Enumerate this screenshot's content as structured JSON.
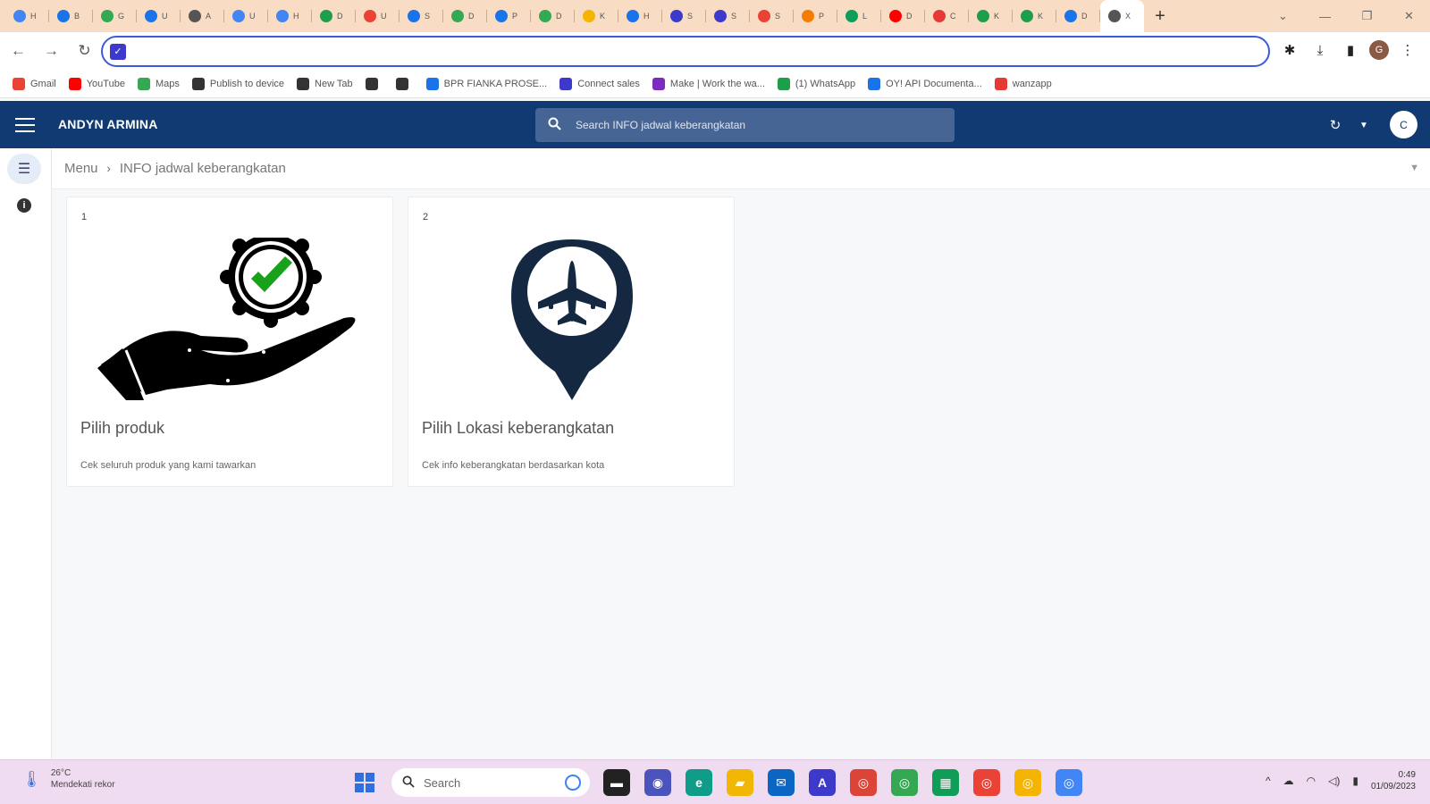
{
  "browser": {
    "tabs": [
      {
        "label": "H",
        "color": "#4285f4",
        "icon": "globe-icon"
      },
      {
        "label": "B",
        "color": "#1a73e8",
        "icon": "filter-icon"
      },
      {
        "label": "G",
        "color": "#34a853",
        "icon": "play-icon"
      },
      {
        "label": "U",
        "color": "#1a73e8",
        "icon": "play-icon"
      },
      {
        "label": "A",
        "color": "#555555",
        "icon": "globe-icon"
      },
      {
        "label": "U",
        "color": "#4285f4",
        "icon": "globe-icon"
      },
      {
        "label": "H",
        "color": "#4285f4",
        "icon": "globe-icon"
      },
      {
        "label": "D",
        "color": "#1e9e4a",
        "icon": "whatsapp-icon"
      },
      {
        "label": "U",
        "color": "#ea4335",
        "icon": "loading-icon"
      },
      {
        "label": "S",
        "color": "#1a73e8",
        "icon": "globe-icon"
      },
      {
        "label": "D",
        "color": "#34a853",
        "icon": "drive-icon"
      },
      {
        "label": "P",
        "color": "#1a73e8",
        "icon": "globe-icon"
      },
      {
        "label": "D",
        "color": "#34a853",
        "icon": "play-icon"
      },
      {
        "label": "K",
        "color": "#f4b400",
        "icon": "drive-icon"
      },
      {
        "label": "H",
        "color": "#1a73e8",
        "icon": "globe-icon"
      },
      {
        "label": "S",
        "color": "#3d3acb",
        "icon": "app-icon"
      },
      {
        "label": "S",
        "color": "#3d3acb",
        "icon": "app-icon"
      },
      {
        "label": "S",
        "color": "#ea4335",
        "icon": "loading-icon"
      },
      {
        "label": "P",
        "color": "#f57c00",
        "icon": "app-icon"
      },
      {
        "label": "L",
        "color": "#0f9d58",
        "icon": "sheets-icon"
      },
      {
        "label": "D",
        "color": "#ff0000",
        "icon": "youtube-icon"
      },
      {
        "label": "C",
        "color": "#e53935",
        "icon": "filter-icon"
      },
      {
        "label": "K",
        "color": "#1e9e4a",
        "icon": "whatsapp-icon"
      },
      {
        "label": "K",
        "color": "#1e9e4a",
        "icon": "whatsapp-icon"
      },
      {
        "label": "D",
        "color": "#1a73e8",
        "icon": "download-icon"
      },
      {
        "label": "X",
        "color": "#555555",
        "icon": "app-icon"
      }
    ],
    "new_tab": "+",
    "window_controls": {
      "dropdown": "⌄",
      "minimize": "—",
      "restore": "❐",
      "close": "✕"
    },
    "nav": {
      "back": "←",
      "forward": "→",
      "reload": "↻"
    },
    "omnibox_value": "",
    "toolbar_icons": {
      "extensions": "✱",
      "download": "⤓",
      "sidepanel": "▮",
      "profile": "G",
      "menu": "⋮"
    },
    "bookmarks": [
      {
        "label": "Gmail",
        "color": "#ea4335",
        "icon": "gmail-icon"
      },
      {
        "label": "YouTube",
        "color": "#ff0000",
        "icon": "youtube-icon"
      },
      {
        "label": "Maps",
        "color": "#34a853",
        "icon": "maps-icon"
      },
      {
        "label": "Publish to device",
        "color": "#333333",
        "icon": "globe-icon"
      },
      {
        "label": "New Tab",
        "color": "#333333",
        "icon": "globe-icon"
      },
      {
        "label": "",
        "color": "#333333",
        "icon": "globe-icon"
      },
      {
        "label": "",
        "color": "#333333",
        "icon": "globe-icon"
      },
      {
        "label": "BPR FIANKA PROSE...",
        "color": "#1a73e8",
        "icon": "filter-icon"
      },
      {
        "label": "Connect sales",
        "color": "#3d3acb",
        "icon": "connect-icon"
      },
      {
        "label": "Make | Work the wa...",
        "color": "#7b2cbf",
        "icon": "make-icon"
      },
      {
        "label": "(1) WhatsApp",
        "color": "#1e9e4a",
        "icon": "whatsapp-icon"
      },
      {
        "label": "OY! API Documenta...",
        "color": "#1a73e8",
        "icon": "api-icon"
      },
      {
        "label": "wanzapp",
        "color": "#e53935",
        "icon": "circle-icon"
      }
    ]
  },
  "app": {
    "name": "ANDYN ARMINA",
    "search_placeholder": "Search INFO jadwal keberangkatan",
    "avatar_initial": "C",
    "header_colors": {
      "appbar": "#123a72",
      "search": "#476594"
    }
  },
  "breadcrumb": {
    "root": "Menu",
    "separator": "›",
    "current": "INFO jadwal keberangkatan"
  },
  "cards": [
    {
      "number": "1",
      "title": "Pilih produk",
      "subtitle": "Cek seluruh produk yang kami tawarkan",
      "icon": "hand-badge-check-icon"
    },
    {
      "number": "2",
      "title": "Pilih Lokasi keberangkatan",
      "subtitle": "Cek info keberangkatan berdasarkan kota",
      "icon": "airplane-location-pin-icon"
    }
  ],
  "taskbar": {
    "weather": {
      "temp": "26°C",
      "desc": "Mendekati rekor"
    },
    "search_placeholder": "Search",
    "apps": [
      {
        "name": "file-manager-icon",
        "color": "#222222",
        "glyph": "▬"
      },
      {
        "name": "chat-icon",
        "color": "#4b53bc",
        "glyph": "◉"
      },
      {
        "name": "edge-icon",
        "color": "#0f9d8a",
        "glyph": "e"
      },
      {
        "name": "folder-icon",
        "color": "#f2b705",
        "glyph": "▰"
      },
      {
        "name": "mail-icon",
        "color": "#0a66c2",
        "glyph": "✉"
      },
      {
        "name": "app-icon",
        "color": "#3d3acb",
        "glyph": "A"
      },
      {
        "name": "chrome-icon",
        "color": "#db4437",
        "glyph": "◎"
      },
      {
        "name": "chrome-icon",
        "color": "#34a853",
        "glyph": "◎"
      },
      {
        "name": "sheets-icon",
        "color": "#0f9d58",
        "glyph": "▦"
      },
      {
        "name": "chrome-icon",
        "color": "#ea4335",
        "glyph": "◎"
      },
      {
        "name": "chrome-icon",
        "color": "#f4b400",
        "glyph": "◎"
      },
      {
        "name": "chrome-icon",
        "color": "#4285f4",
        "glyph": "◎"
      }
    ],
    "tray": {
      "chevron": "^",
      "sync": "☁",
      "wifi": "📶",
      "volume": "🔊",
      "battery": "▮"
    },
    "clock": {
      "time": "0:49",
      "date": "01/09/2023"
    }
  }
}
